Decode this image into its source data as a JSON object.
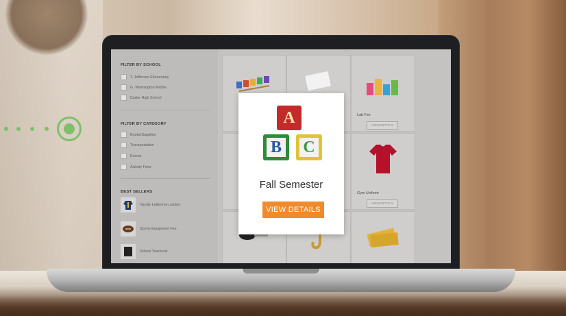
{
  "sidebar": {
    "school_heading": "FILTER BY SCHOOL",
    "schools": [
      "T. Jefferson Elementary",
      "G. Washington Middle",
      "Carter High School"
    ],
    "category_heading": "FILTER BY CATEGORY",
    "categories": [
      "Books/Supplies",
      "Transportation",
      "Events",
      "Activity Fees"
    ],
    "best_heading": "BEST SELLERS",
    "best_sellers": [
      "Varsity Letterman Jacket",
      "Sports Equipment Fee",
      "School Yearbook"
    ]
  },
  "products": {
    "lab_fee": "Lab Fee",
    "gym_uniform": "Gym Uniform",
    "view_details": "VIEW DETAILS"
  },
  "modal": {
    "block_letters": [
      "A",
      "B",
      "C"
    ],
    "title": "Fall Semester",
    "button": "VIEW DETAILS"
  },
  "colors": {
    "accent": "#f08a2d",
    "pointer": "#7dc06b"
  }
}
